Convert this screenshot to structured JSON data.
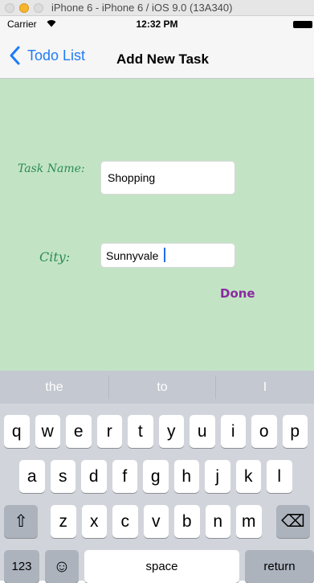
{
  "simulator": {
    "window_title": "iPhone 6 - iPhone 6 / iOS 9.0 (13A340)"
  },
  "status_bar": {
    "carrier": "Carrier",
    "time": "12:32 PM",
    "wifi_icon": "wifi-icon",
    "battery_icon": "battery-icon"
  },
  "nav_bar": {
    "back_label": "Todo List",
    "back_icon": "chevron-left-icon",
    "title": "Add New Task",
    "accent_color": "#1e7cf6"
  },
  "form": {
    "task_label": "Task Name:",
    "task_value": "Shopping",
    "city_label": "City:",
    "city_value": "Sunnyvale",
    "done_label": "Done",
    "background_color": "#c2e4c5",
    "label_color": "#2e8b57",
    "done_color": "#8a2aa0"
  },
  "keyboard": {
    "suggestions": [
      "the",
      "to",
      "I"
    ],
    "row1": [
      "q",
      "w",
      "e",
      "r",
      "t",
      "y",
      "u",
      "i",
      "o",
      "p"
    ],
    "row2": [
      "a",
      "s",
      "d",
      "f",
      "g",
      "h",
      "j",
      "k",
      "l"
    ],
    "row3": [
      "z",
      "x",
      "c",
      "v",
      "b",
      "n",
      "m"
    ],
    "shift_icon": "⇧",
    "delete_icon": "⌫",
    "numbers_label": "123",
    "emoji_icon": "☺",
    "space_label": "space",
    "return_label": "return"
  }
}
